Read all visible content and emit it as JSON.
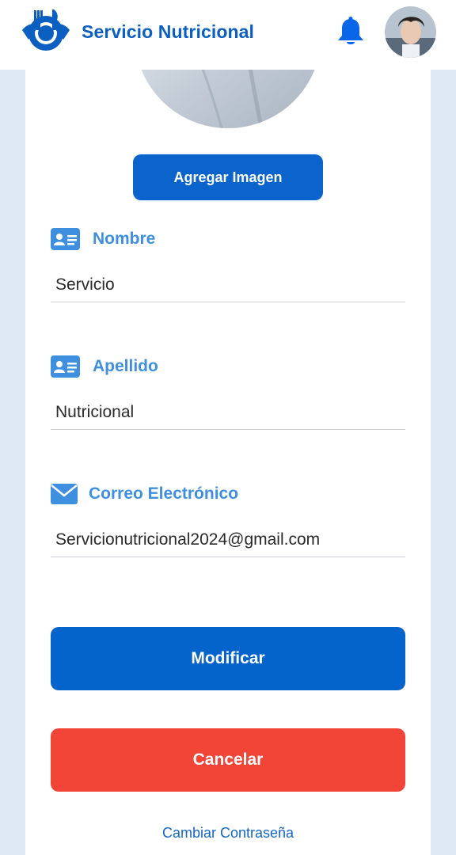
{
  "header": {
    "app_title": "Servicio Nutricional",
    "logo_icon": "plate-fork-knife-logo-icon",
    "notification_icon": "bell-icon",
    "avatar_icon": "user-avatar"
  },
  "profile": {
    "photo_icon": "profile-photo",
    "add_image_label": "Agregar Imagen"
  },
  "form": {
    "nombre": {
      "label": "Nombre",
      "value": "Servicio",
      "icon": "id-card-icon"
    },
    "apellido": {
      "label": "Apellido",
      "value": "Nutricional",
      "icon": "id-card-icon"
    },
    "correo": {
      "label": "Correo Electrónico",
      "value": "Servicionutricional2024@gmail.com",
      "icon": "envelope-icon"
    }
  },
  "actions": {
    "modify_label": "Modificar",
    "cancel_label": "Cancelar",
    "change_password_label": "Cambiar Contraseña"
  },
  "colors": {
    "primary": "#0564cc",
    "danger": "#f24537",
    "label": "#3f8fe0",
    "background": "#dde8f3"
  }
}
